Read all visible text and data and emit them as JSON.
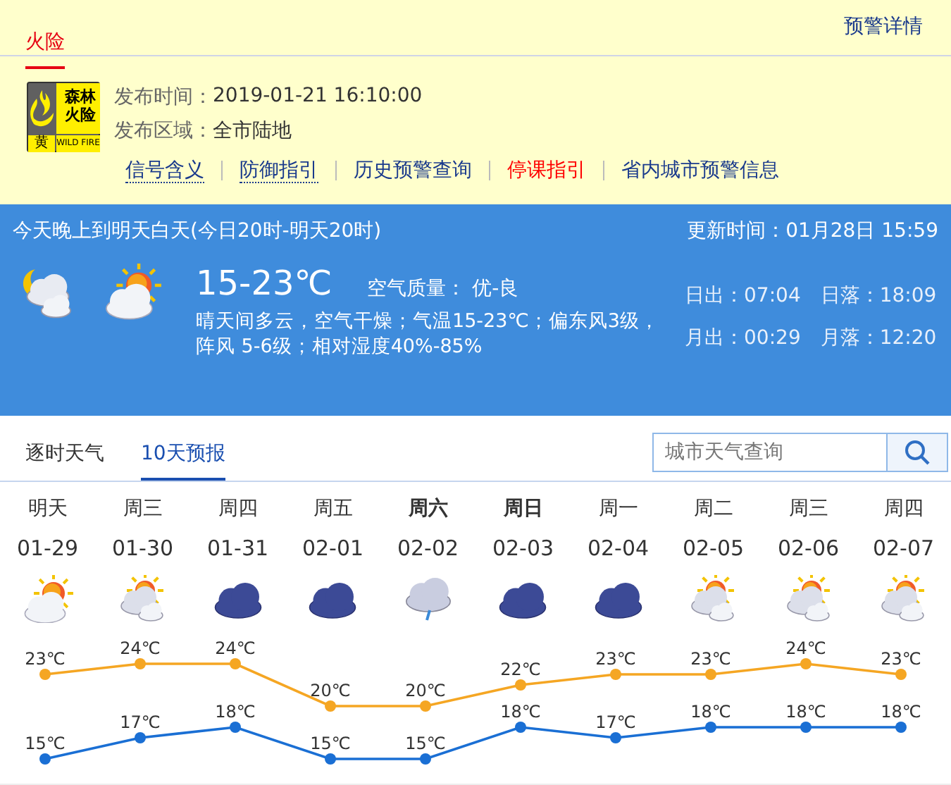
{
  "warning_tabs": [
    {
      "label": "火险",
      "selected": true
    }
  ],
  "details_link": "预警详情",
  "signal": {
    "name": "森林火险",
    "grade": "黄",
    "english": "WILD FIRE"
  },
  "issue": [
    {
      "label": "发布时间：",
      "value": "2019-01-21 16:10:00"
    },
    {
      "label": "发布区域：",
      "value": "全市陆地"
    }
  ],
  "links": [
    {
      "label": "信号含义",
      "underlined": true,
      "color": "#1a3a8c"
    },
    {
      "label": "防御指引",
      "underlined": true,
      "color": "#1a3a8c"
    },
    {
      "label": "历史预警查询",
      "underlined": false,
      "color": "#1a3a8c"
    },
    {
      "label": "停课指引",
      "underlined": false,
      "color": "#ff0000"
    },
    {
      "label": "省内城市预警信息",
      "underlined": false,
      "color": "#1a3a8c"
    }
  ],
  "forecast": {
    "period": "今天晚上到明天白天(今日20时-明天20时)",
    "updated": "更新时间：01月28日 15:59",
    "icons": [
      {
        "kind": "moon-cloud"
      },
      {
        "kind": "sun-cloud"
      }
    ],
    "temperature": "15-23℃",
    "air_quality": "空气质量： 优-良",
    "description": "晴天间多云，空气干燥；气温15-23℃；偏东风3级，阵风 5-6级；相对湿度40%-85%",
    "sun_moon": [
      {
        "label": "日出：",
        "value": "07:04"
      },
      {
        "label": "日落：",
        "value": "18:09"
      },
      {
        "label": "月出：",
        "value": "00:29"
      },
      {
        "label": "月落：",
        "value": "12:20"
      }
    ]
  },
  "view_tabs": [
    {
      "label": "逐时天气",
      "selected": false
    },
    {
      "label": "10天预报",
      "selected": true
    }
  ],
  "search": {
    "placeholder": "城市天气查询"
  },
  "days": [
    {
      "day": "明天",
      "kind": "sun-cloud",
      "weekend": false
    },
    {
      "day": "周三",
      "kind": "partly-cloudy",
      "weekend": false
    },
    {
      "day": "周四",
      "kind": "overcast",
      "weekend": false
    },
    {
      "day": "周五",
      "kind": "overcast",
      "weekend": false
    },
    {
      "day": "周六",
      "kind": "rain",
      "weekend": true
    },
    {
      "day": "周日",
      "kind": "overcast",
      "weekend": true
    },
    {
      "day": "周一",
      "kind": "overcast",
      "weekend": false
    },
    {
      "day": "周二",
      "kind": "partly-cloudy",
      "weekend": false
    },
    {
      "day": "周三",
      "kind": "partly-cloudy",
      "weekend": false
    },
    {
      "day": "周四",
      "kind": "partly-cloudy",
      "weekend": false
    }
  ],
  "chart_data": {
    "type": "line",
    "categories": [
      "01-29",
      "01-30",
      "01-31",
      "02-01",
      "02-02",
      "02-03",
      "02-04",
      "02-05",
      "02-06",
      "02-07"
    ],
    "data_labels": "value_labels",
    "series": [
      {
        "color": "#f5a623",
        "marker": "circle",
        "values": [
          23,
          24,
          24,
          20,
          20,
          22,
          23,
          23,
          24,
          23
        ],
        "value_labels": [
          "23℃",
          "24℃",
          "24℃",
          "20℃",
          "20℃",
          "22℃",
          "23℃",
          "23℃",
          "24℃",
          "23℃"
        ]
      },
      {
        "color": "#1a6fd4",
        "marker": "circle",
        "values": [
          15,
          17,
          18,
          15,
          15,
          18,
          17,
          18,
          18,
          18
        ],
        "value_labels": [
          "15℃",
          "17℃",
          "18℃",
          "15℃",
          "15℃",
          "18℃",
          "17℃",
          "18℃",
          "18℃",
          "18℃"
        ]
      }
    ]
  }
}
